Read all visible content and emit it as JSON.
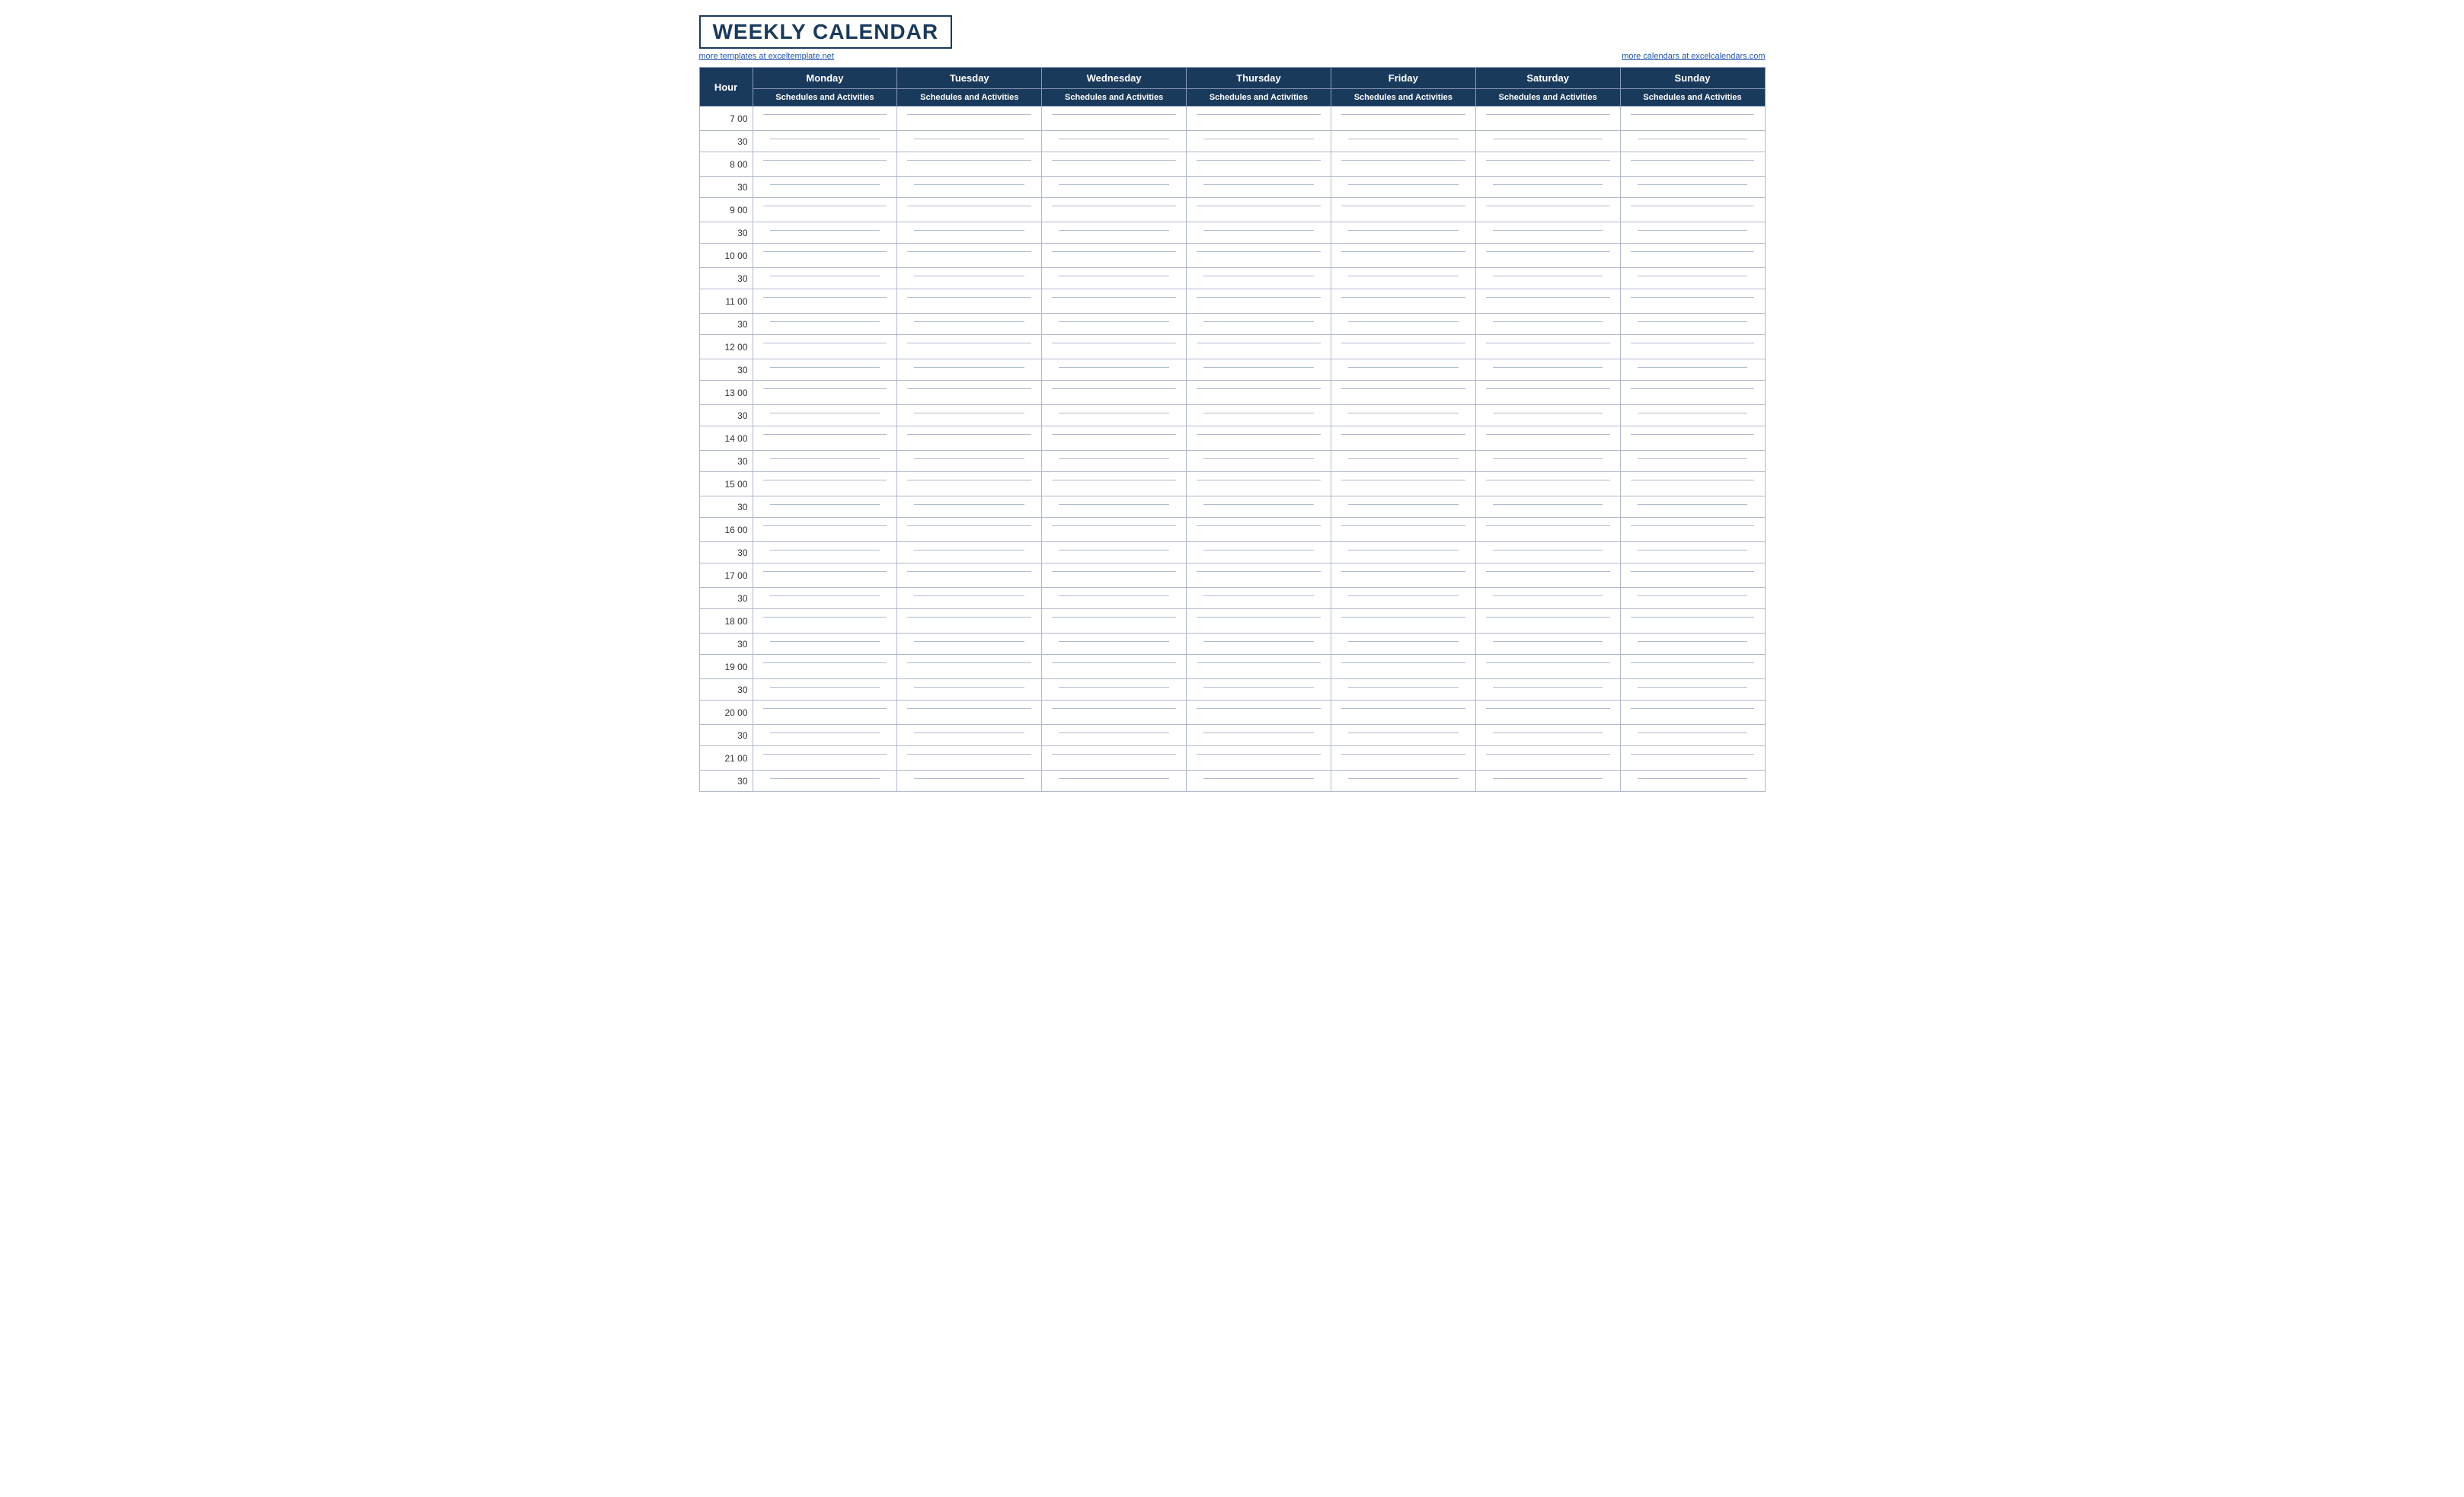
{
  "title": "WEEKLY CALENDAR",
  "links": {
    "left": "more templates at exceltemplate.net",
    "right": "more calendars at excelcalendars.com"
  },
  "header": {
    "hour_label": "Hour",
    "days": [
      "Monday",
      "Tuesday",
      "Wednesday",
      "Thursday",
      "Friday",
      "Saturday",
      "Sunday"
    ],
    "subheader": "Schedules and Activities"
  },
  "hours": [
    {
      "label": "7  00",
      "half": "30"
    },
    {
      "label": "8  00",
      "half": "30"
    },
    {
      "label": "9  00",
      "half": "30"
    },
    {
      "label": "10  00",
      "half": "30"
    },
    {
      "label": "11  00",
      "half": "30"
    },
    {
      "label": "12  00",
      "half": "30"
    },
    {
      "label": "13  00",
      "half": "30"
    },
    {
      "label": "14  00",
      "half": "30"
    },
    {
      "label": "15  00",
      "half": "30"
    },
    {
      "label": "16  00",
      "half": "30"
    },
    {
      "label": "17  00",
      "half": "30"
    },
    {
      "label": "18  00",
      "half": "30"
    },
    {
      "label": "19  00",
      "half": "30"
    },
    {
      "label": "20  00",
      "half": "30"
    },
    {
      "label": "21  00",
      "half": "30"
    }
  ],
  "accent_color": "#1a3a5c",
  "line_color": "#b0bbd0"
}
